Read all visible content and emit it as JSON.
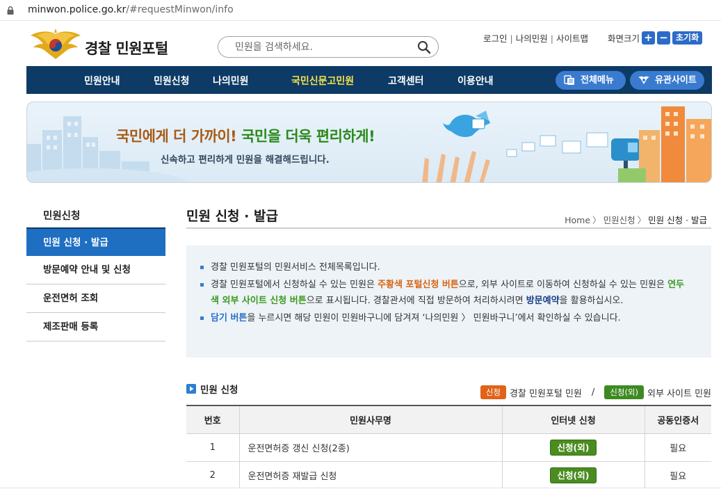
{
  "browser": {
    "url_host": "minwon.police.go.kr",
    "url_path": "/#requestMinwon/info"
  },
  "header": {
    "logo_text": "경찰 민원포털",
    "search_placeholder": "민원을 검색하세요.",
    "util_links": [
      "로그인",
      "나의민원",
      "사이트맵"
    ],
    "font_size_label": "화면크기",
    "font_plus": "+",
    "font_minus": "−",
    "font_reset": "초기화"
  },
  "gnb": {
    "menus": [
      "민원안내",
      "민원신청",
      "나의민원",
      "국민신문고민원",
      "고객센터",
      "이용안내"
    ],
    "active_index": 3,
    "all_menu": "전체메뉴",
    "related_sites": "유관사이트",
    "active_color": "#f3e24a",
    "bar_color": "#0d3b66"
  },
  "banner": {
    "headline_a": "국민에게 더 가까이!",
    "headline_b": "국민을 더욱 편리하게!",
    "sub": "신속하고 편리하게 민원을 해결해드립니다."
  },
  "lnb": {
    "title": "민원신청",
    "items": [
      "민원 신청 · 발급",
      "방문예약 안내 및 신청",
      "운전면허 조회",
      "제조판매 등록"
    ],
    "active_index": 0
  },
  "content": {
    "title": "민원 신청 · 발급",
    "breadcrumb": [
      "Home",
      "민원신청",
      "민원 신청 · 발급"
    ],
    "info": {
      "line1": "경찰 민원포털의 민원서비스 전체목록입니다.",
      "line2_a": "경찰 민원포털에서 신청하실 수 있는 민원은 ",
      "line2_b": "주황색 포털신청 버튼",
      "line2_c": "으로, 외부 사이트로 이동하여 신청하실 수 있는 민원은 ",
      "line2_d": "연두색 외부 사이트 신청 버튼",
      "line2_e": "으로 표시됩니다. 경찰관서에 직접 방문하여 처리하시려면 ",
      "line2_f": "방문예약",
      "line2_g": "을 활용하십시오.",
      "line3_a": "담기 버튼",
      "line3_b": "을 누르시면 해당 민원이 민원바구니에 담겨져 ‘나의민원 〉 민원바구니’에서 확인하실 수 있습니다."
    },
    "section_title": "민원 신청",
    "legend": {
      "portal_tag": "신청",
      "portal_label": "경찰 민원포털 민원",
      "separator": "/",
      "external_tag": "신청(외)",
      "external_label": "외부 사이트 민원"
    },
    "table": {
      "headers": [
        "번호",
        "민원사무명",
        "인터넷 신청",
        "공동인증서"
      ],
      "rows": [
        {
          "no": "1",
          "name": "운전면허증 갱신 신청(2종)",
          "apply": "신청(외)",
          "cert": "필요"
        },
        {
          "no": "2",
          "name": "운전면허증 재발급 신청",
          "apply": "신청(외)",
          "cert": "필요"
        }
      ]
    }
  }
}
